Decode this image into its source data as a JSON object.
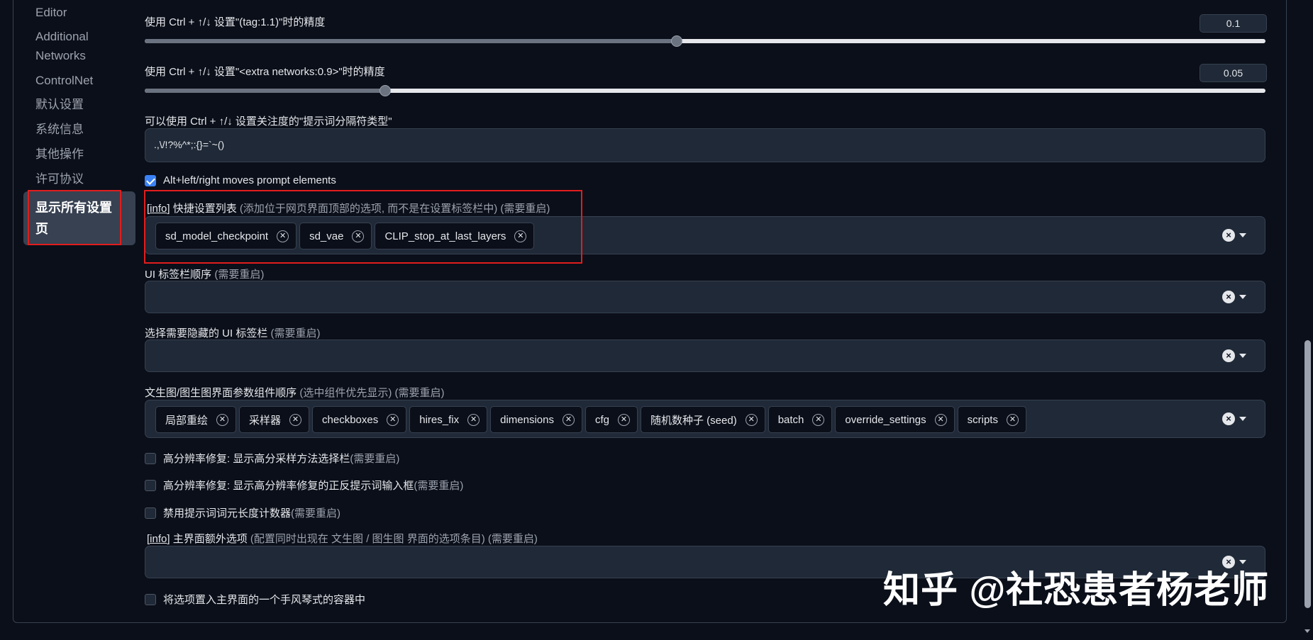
{
  "sidebar": {
    "items": [
      {
        "label": "Editor"
      },
      {
        "label": "Additional Networks"
      },
      {
        "label": "ControlNet"
      },
      {
        "label": "默认设置"
      },
      {
        "label": "系统信息"
      },
      {
        "label": "其他操作"
      },
      {
        "label": "许可协议"
      },
      {
        "label": "显示所有设置页"
      }
    ]
  },
  "settings": {
    "tag_precision": {
      "label": "使用 Ctrl + ↑/↓ 设置\"(tag:1.1)\"时的精度",
      "value": "0.1",
      "fraction": 0.474
    },
    "network_precision": {
      "label": "使用 Ctrl + ↑/↓ 设置\"<extra networks:0.9>\"时的精度",
      "value": "0.05",
      "fraction": 0.214
    },
    "separators": {
      "label": "可以使用 Ctrl + ↑/↓ 设置关注度的\"提示词分隔符类型\"",
      "value": ".,\\/!?%^*;:{}=`~()"
    },
    "alt_move": {
      "label": "Alt+left/right moves prompt elements",
      "checked": true
    },
    "quicksettings": {
      "info": "[info]",
      "title": " 快捷设置列表 ",
      "note": "(添加位于网页界面顶部的选项, 而不是在设置标签栏中) (需要重启)",
      "tags": [
        "sd_model_checkpoint",
        "sd_vae",
        "CLIP_stop_at_last_layers"
      ]
    },
    "tab_order": {
      "title": "UI 标签栏顺序 ",
      "note": "(需要重启)"
    },
    "hidden_tabs": {
      "title": "选择需要隐藏的 UI 标签栏 ",
      "note": "(需要重启)"
    },
    "ui_order": {
      "title": "文生图/图生图界面参数组件顺序 ",
      "note": "(选中组件优先显示) (需要重启)",
      "tags": [
        "局部重绘",
        "采样器",
        "checkboxes",
        "hires_fix",
        "dimensions",
        "cfg",
        "随机数种子 (seed)",
        "batch",
        "override_settings",
        "scripts"
      ]
    },
    "hires_sampler": {
      "title": "高分辨率修复: 显示高分采样方法选择栏 ",
      "note": "(需要重启)",
      "checked": false
    },
    "hires_prompts": {
      "title": "高分辨率修复: 显示高分辨率修复的正反提示词输入框 ",
      "note": "(需要重启)",
      "checked": false
    },
    "disable_counter": {
      "title": "禁用提示词词元长度计数器 ",
      "note": "(需要重启)",
      "checked": false
    },
    "extra_options": {
      "info": "[info]",
      "title": " 主界面额外选项 ",
      "note": "(配置同时出现在 文生图 / 图生图 界面的选项条目) (需要重启)"
    },
    "accordion": {
      "label": "将选项置入主界面的一个手风琴式的容器中",
      "checked": false
    }
  },
  "watermark": "知乎 @社恐患者杨老师",
  "colors": {
    "accent": "#3b82f6",
    "highlight": "#e11d1d",
    "background": "#0b0f19",
    "panel": "#1f2937"
  }
}
